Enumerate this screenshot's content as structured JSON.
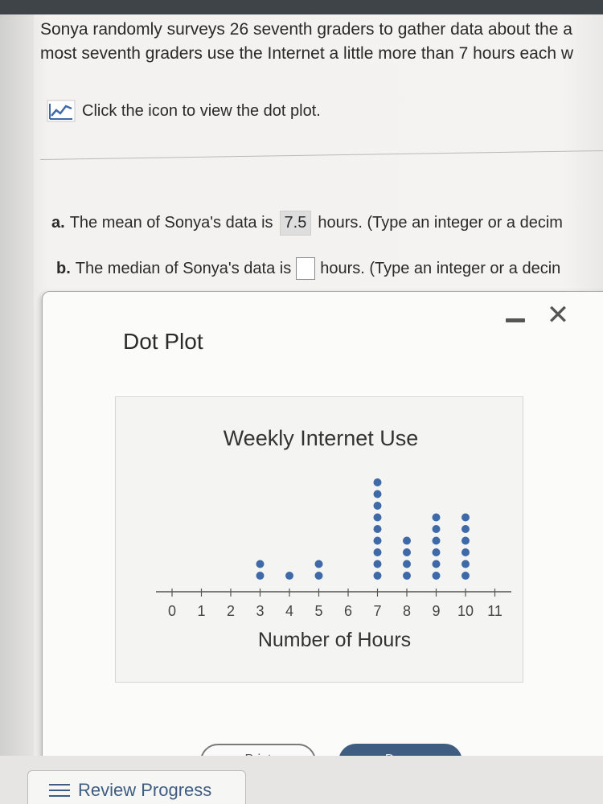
{
  "question": {
    "line1": "Sonya randomly surveys 26 seventh graders to gather data about the a",
    "line2": "most seventh graders use the Internet a little more than 7 hours each w"
  },
  "plot_link": {
    "label": "Click the icon to view the dot plot.",
    "icon": "chart-icon"
  },
  "part_a": {
    "letter": "a.",
    "text_before": "The mean of Sonya's data is",
    "answer": "7.5",
    "text_after": "hours. (Type an integer or a decim"
  },
  "part_b": {
    "letter": "b.",
    "text_before": "The median of Sonya's data is",
    "answer": "",
    "text_after": "hours. (Type an integer or a decin"
  },
  "dialog": {
    "title": "Dot Plot",
    "close_glyph": "✕",
    "print_label": "Print",
    "done_label": "Done"
  },
  "footer": {
    "review_label": "Review Progress"
  },
  "chart_data": {
    "type": "scatter",
    "title": "Weekly Internet Use",
    "xlabel": "Number of Hours",
    "ylabel": "",
    "x_ticks": [
      0,
      1,
      2,
      3,
      4,
      5,
      6,
      7,
      8,
      9,
      10,
      11
    ],
    "xlim": [
      0,
      11
    ],
    "grid": false,
    "dot_color": "#3f6aa8",
    "counts": [
      {
        "x": 3,
        "count": 2
      },
      {
        "x": 4,
        "count": 1
      },
      {
        "x": 5,
        "count": 2
      },
      {
        "x": 7,
        "count": 9
      },
      {
        "x": 8,
        "count": 4
      },
      {
        "x": 9,
        "count": 6
      },
      {
        "x": 10,
        "count": 6
      }
    ]
  }
}
